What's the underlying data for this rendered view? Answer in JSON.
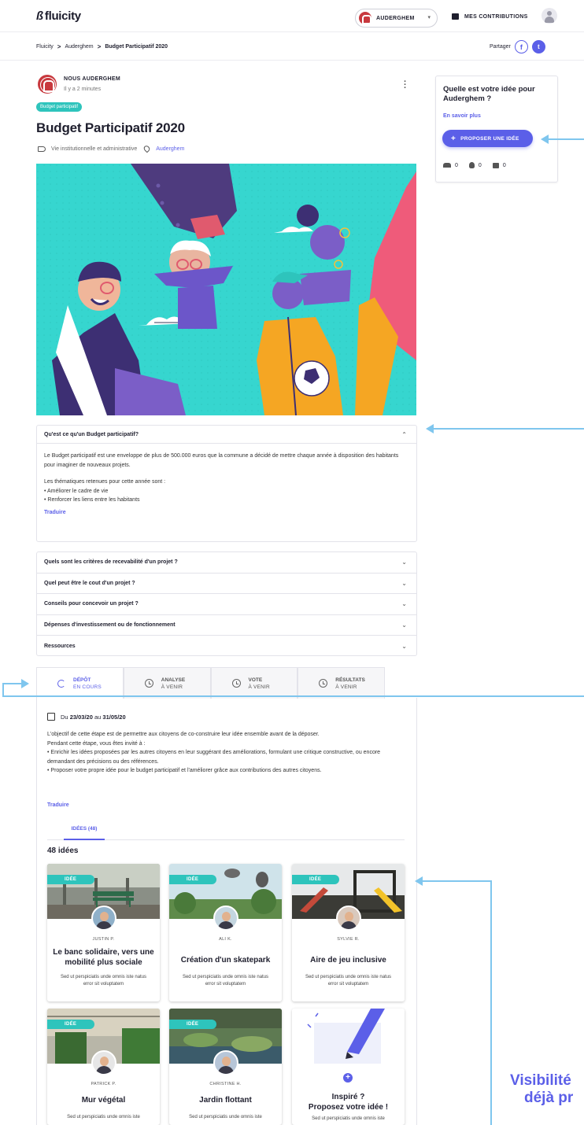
{
  "header": {
    "logo_mark": "ß",
    "logo_text": "fluicity",
    "commune_label": "AUDERGHEM",
    "contrib_label": "MES CONTRIBUTIONS"
  },
  "breadcrumb": {
    "items": [
      "Fluicity",
      "Auderghem",
      "Budget Participatif 2020"
    ],
    "separator": ">"
  },
  "share": {
    "label": "Partager"
  },
  "post": {
    "author": "NOUS AUDERGHEM",
    "time": "Il y a 2 minutes",
    "badge": "Budget participatif",
    "title": "Budget Participatif 2020",
    "category": "Vie institutionnelle et administrative",
    "location": "Auderghem"
  },
  "faq_open": {
    "question": "Qu'est ce qu'un Budget participatif?",
    "paragraph1": "Le Budget participatif est une enveloppe de plus de 500.000 euros que la commune a décidé de mettre chaque année à disposition des habitants pour imaginer de nouveaux projets.",
    "paragraph2_intro": "Les thématiques retenues pour cette année sont :",
    "bullet1": "• Améliorer le cadre de vie",
    "bullet2": "• Renforcer les liens entre les habitants",
    "translate": "Traduire"
  },
  "faq": [
    "Quels sont les critères de recevabilité d'un projet ?",
    "Quel peut être le cout d'un projet ?",
    "Conseils pour concevoir un projet ?",
    "Dépenses d'investissement ou de fonctionnement",
    "Ressources"
  ],
  "steps": [
    {
      "name": "DÉPÔT",
      "status": "EN COURS"
    },
    {
      "name": "ANALYSE",
      "status": "À VENIR"
    },
    {
      "name": "VOTE",
      "status": "À VENIR"
    },
    {
      "name": "RÉSULTATS",
      "status": "À VENIR"
    }
  ],
  "step": {
    "dates_prefix": "Du",
    "date_start": "23/03/20",
    "dates_mid": "au",
    "date_end": "31/05/20",
    "line1": "L'objectif de cette étape est de permettre aux citoyens de co-construire leur idée ensemble avant de la déposer.",
    "line2": "Pendant cette étape, vous êtes invité à :",
    "line3": "• Enrichir les idées proposées par les autres citoyens en leur suggérant des améliorations, formulant une critique constructive, ou encore demandant des précisions ou des références.",
    "line4": "• Proposer votre propre idée pour le budget participatif et l'améliorer grâce aux contributions des autres citoyens.",
    "translate": "Traduire",
    "ideas_tab": "IDÉES (48)",
    "ideas_count": "48 idées"
  },
  "cards": [
    {
      "pill": "IDÉE",
      "author": "JUSTIN P.",
      "title": "Le banc solidaire, vers une mobilité plus sociale",
      "desc": "Sed ut perspiciatis unde omnis iste natus error sit voluptatem"
    },
    {
      "pill": "IDÉE",
      "author": "ALI K.",
      "title": "Création d'un skatepark",
      "desc": "Sed ut perspiciatis unde omnis iste natus error sit voluptatem"
    },
    {
      "pill": "IDÉE",
      "author": "SYLVIE R.",
      "title": "Aire de jeu inclusive",
      "desc": "Sed ut perspiciatis unde omnis iste natus error sit voluptatem"
    },
    {
      "pill": "IDÉE",
      "author": "PATRICK P.",
      "title": "Mur végétal",
      "desc": "Sed ut perspiciatis unde omnis iste"
    },
    {
      "pill": "IDÉE",
      "author": "CHRISTINE H.",
      "title": "Jardin flottant",
      "desc": "Sed ut perspiciatis unde omnis iste"
    }
  ],
  "add_card": {
    "title_line1": "Inspiré ?",
    "title_line2": "Proposez votre idée !",
    "desc": "Sed ut perspiciatis unde omnis iste"
  },
  "sidebar": {
    "question": "Quelle est votre idée pour Auderghem ?",
    "learn_more": "En savoir plus",
    "propose": "PROPOSER UNE IDÉE",
    "stat_people": "0",
    "stat_ideas": "0",
    "stat_comments": "0"
  },
  "caption": {
    "line1": "Visibilité",
    "line2": "déjà pr"
  },
  "colors": {
    "accent": "#5b5fe8",
    "teal": "#2ec4bc",
    "seal_red": "#c8393e",
    "arrow_blue": "#7fc6ee"
  }
}
